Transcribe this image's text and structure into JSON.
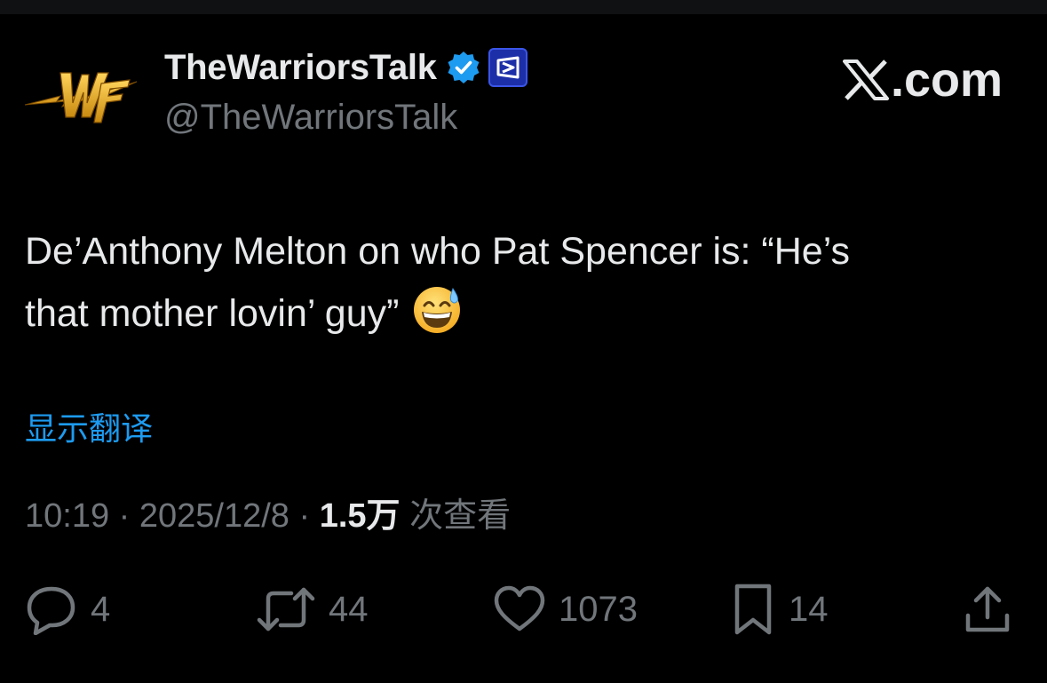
{
  "account": {
    "display_name": "TheWarriorsTalk",
    "handle": "@TheWarriorsTalk",
    "avatar_icon": "warriors-logo-icon",
    "verified_icon": "verified-badge-icon",
    "affiliate_icon": "affiliate-badge-icon"
  },
  "brand": {
    "label": ".com",
    "icon": "x-logo-icon"
  },
  "tweet": {
    "text_line1": "De’Anthony Melton on who Pat Spencer is: “He’s",
    "text_line2": "that mother lovin’ guy”",
    "emoji": "grinning-face-with-sweat-emoji"
  },
  "translate_label": "显示翻译",
  "meta": {
    "time": "10:19",
    "separator": " · ",
    "date": "2025/12/8",
    "views_count": "1.5万",
    "views_label": " 次查看"
  },
  "actions": {
    "reply_count": "4",
    "retweet_count": "44",
    "like_count": "1073",
    "bookmark_count": "14"
  },
  "colors": {
    "background": "#000000",
    "text": "#e7e9ea",
    "secondary": "#71767b",
    "accent": "#1d9bf0",
    "logo_gold": "#f2b01e"
  }
}
